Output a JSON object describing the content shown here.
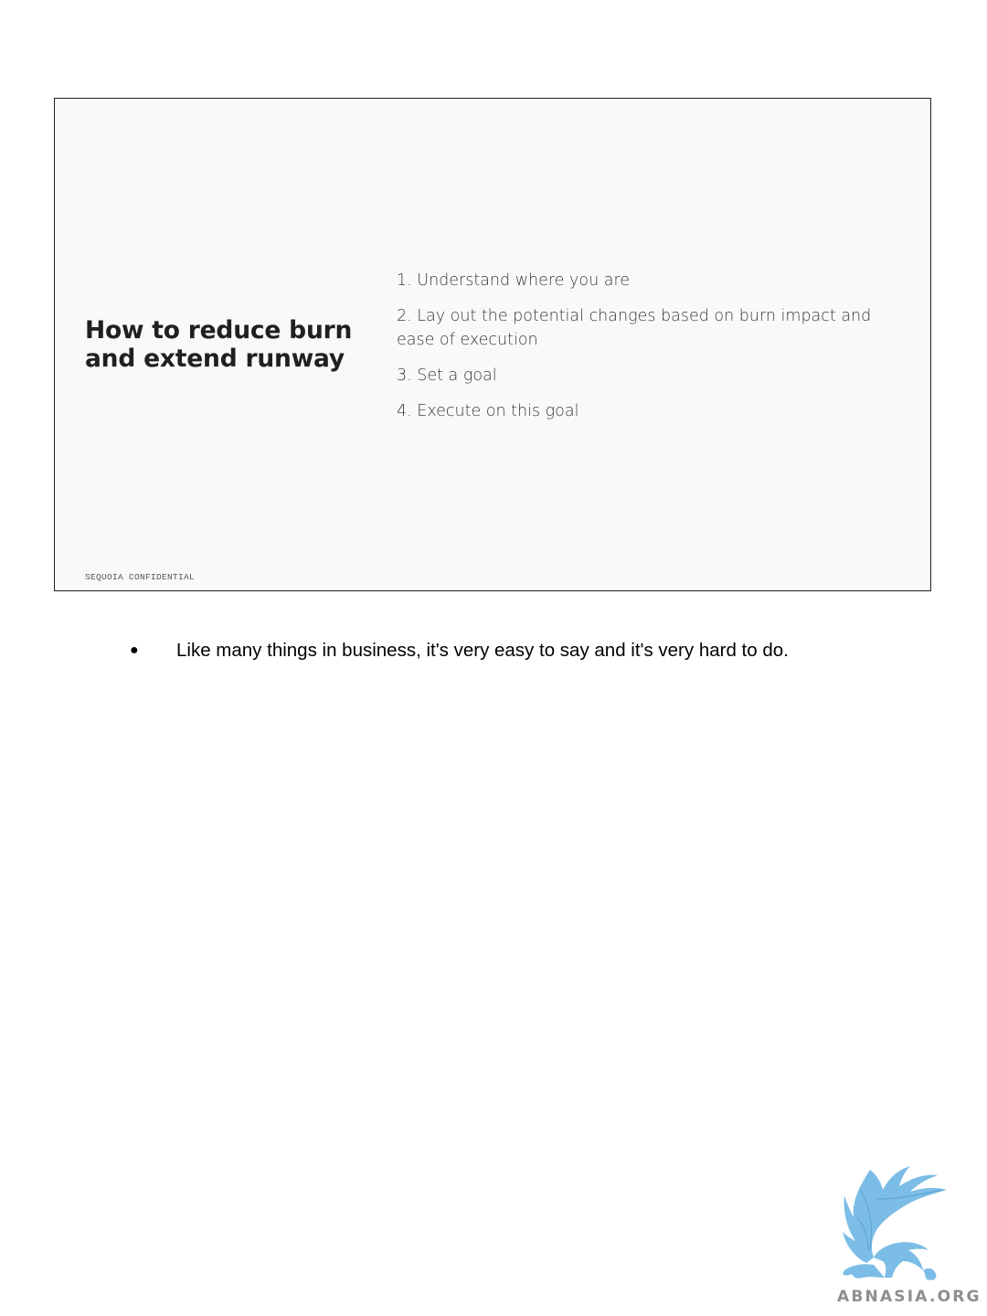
{
  "slide": {
    "title": "How to reduce burn and extend runway",
    "steps": [
      "1. Understand where you are",
      "2. Lay out the potential changes based on burn impact and ease of execution",
      "3. Set a goal",
      "4. Execute on this goal"
    ],
    "footer": "SEQUOIA CONFIDENTIAL"
  },
  "notes": {
    "bullets": [
      "Like many things in business, it's very easy to say and it's very hard to do."
    ]
  },
  "watermark": {
    "text": "ABNASIA.ORG",
    "icon": "griffin-logo-icon",
    "color": "#7bbde6"
  }
}
